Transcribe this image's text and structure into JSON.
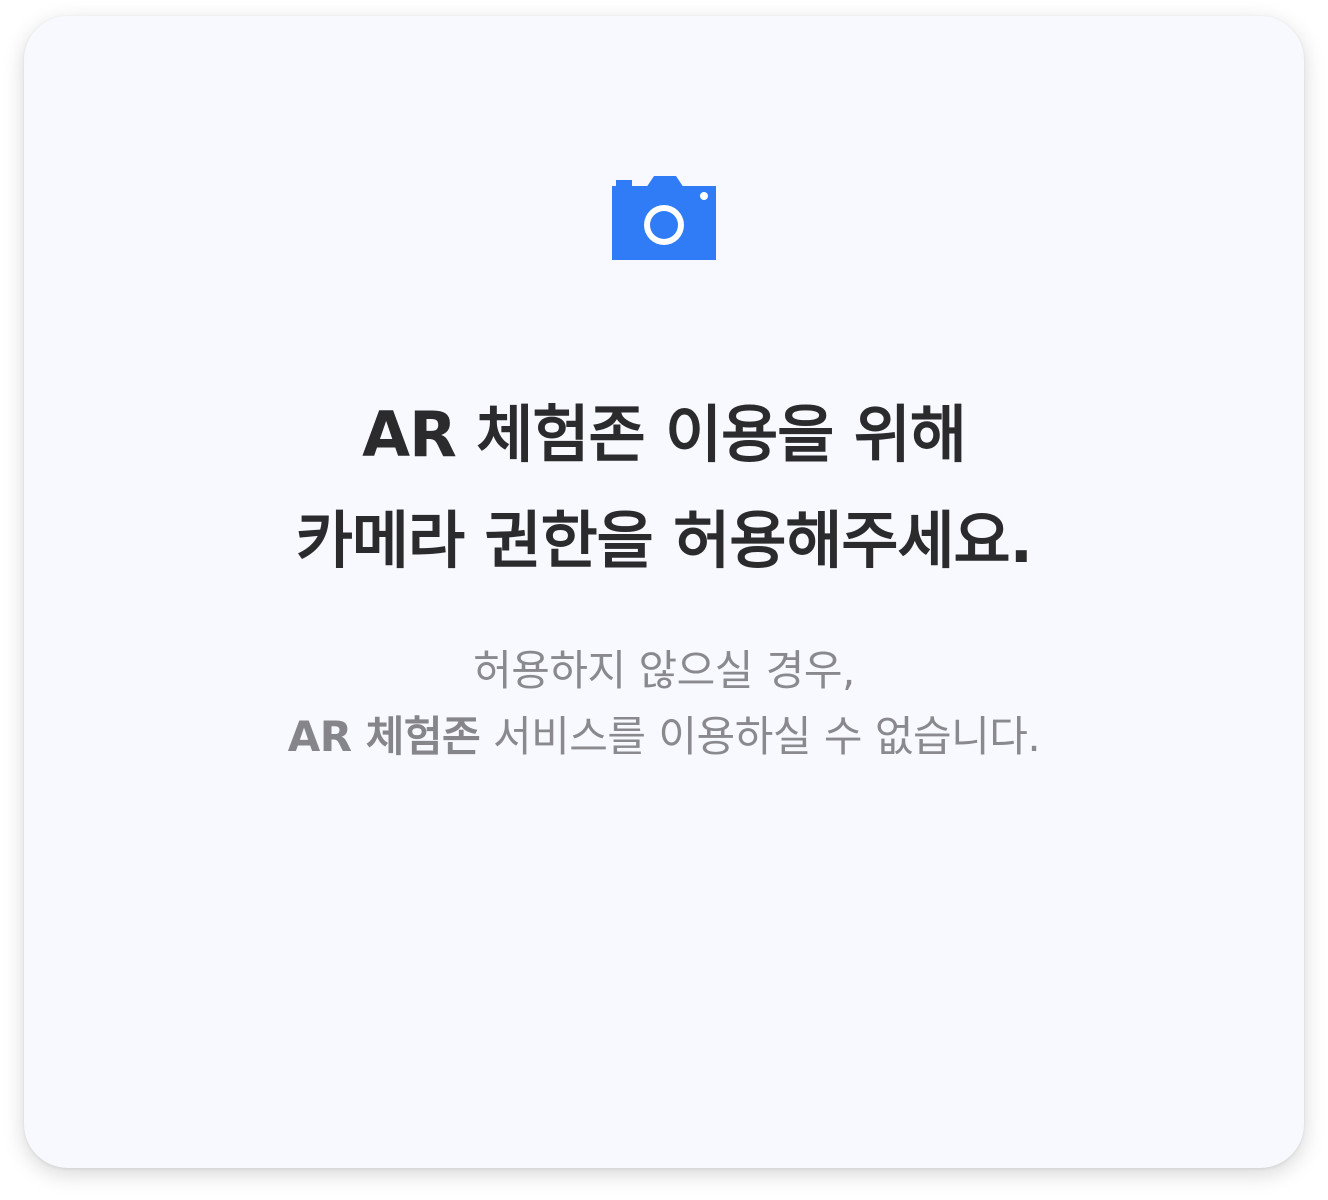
{
  "dialog": {
    "icon": "camera-icon",
    "accent_color": "#2f7cf6",
    "title_line1": "AR 체험존 이용을 위해",
    "title_line2": "카메라 권한을 허용해주세요.",
    "desc_line1": "허용하지 않으실 경우,",
    "desc_line2_bold": "AR 체험존",
    "desc_line2_rest": " 서비스를 이용하실 수 없습니다."
  }
}
